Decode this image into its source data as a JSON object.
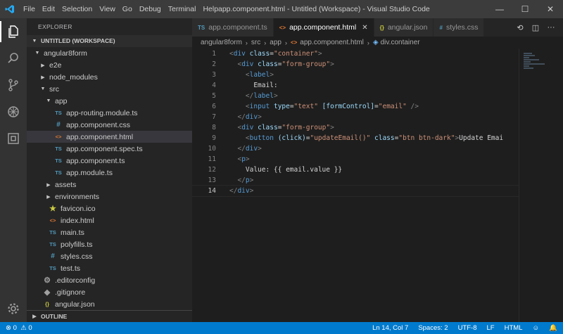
{
  "titlebar": {
    "menu": [
      "File",
      "Edit",
      "Selection",
      "View",
      "Go",
      "Debug",
      "Terminal",
      "Help"
    ],
    "title": "app.component.html - Untitled (Workspace) - Visual Studio Code",
    "controls": [
      "—",
      "☐",
      "✕"
    ]
  },
  "activity": {
    "icons": [
      "files-icon",
      "search-icon",
      "source-control-icon",
      "debug-icon",
      "extensions-icon"
    ],
    "bottom_icon": "settings-gear-icon"
  },
  "sidebar": {
    "title": "EXPLORER",
    "workspace": "UNTITLED (WORKSPACE)",
    "items": [
      {
        "label": "angular8form",
        "kind": "folder-open",
        "depth": 0
      },
      {
        "label": "e2e",
        "kind": "folder",
        "depth": 1
      },
      {
        "label": "node_modules",
        "kind": "folder",
        "depth": 1
      },
      {
        "label": "src",
        "kind": "folder-open",
        "depth": 1
      },
      {
        "label": "app",
        "kind": "folder-open",
        "depth": 2
      },
      {
        "label": "app-routing.module.ts",
        "kind": "ts",
        "depth": 3
      },
      {
        "label": "app.component.css",
        "kind": "css",
        "depth": 3
      },
      {
        "label": "app.component.html",
        "kind": "html",
        "depth": 3,
        "selected": true
      },
      {
        "label": "app.component.spec.ts",
        "kind": "ts",
        "depth": 3
      },
      {
        "label": "app.component.ts",
        "kind": "ts",
        "depth": 3
      },
      {
        "label": "app.module.ts",
        "kind": "ts",
        "depth": 3
      },
      {
        "label": "assets",
        "kind": "folder",
        "depth": 2
      },
      {
        "label": "environments",
        "kind": "folder",
        "depth": 2
      },
      {
        "label": "favicon.ico",
        "kind": "star",
        "depth": 2
      },
      {
        "label": "index.html",
        "kind": "html",
        "depth": 2
      },
      {
        "label": "main.ts",
        "kind": "ts",
        "depth": 2
      },
      {
        "label": "polyfills.ts",
        "kind": "ts",
        "depth": 2
      },
      {
        "label": "styles.css",
        "kind": "css",
        "depth": 2
      },
      {
        "label": "test.ts",
        "kind": "ts",
        "depth": 2
      },
      {
        "label": ".editorconfig",
        "kind": "gear",
        "depth": 1
      },
      {
        "label": ".gitignore",
        "kind": "plain",
        "depth": 1
      },
      {
        "label": "angular.json",
        "kind": "json",
        "depth": 1
      }
    ],
    "outline": "OUTLINE"
  },
  "tabs": [
    {
      "label": "app.component.ts",
      "kind": "ts",
      "active": false
    },
    {
      "label": "app.component.html",
      "kind": "html",
      "active": true
    },
    {
      "label": "angular.json",
      "kind": "json",
      "active": false
    },
    {
      "label": "styles.css",
      "kind": "css",
      "active": false
    }
  ],
  "breadcrumb": [
    "angular8form",
    "src",
    "app",
    "app.component.html",
    "div.container"
  ],
  "editor": {
    "current_line": 14,
    "lines": [
      [
        [
          "tg",
          "<"
        ],
        [
          "tn",
          "div"
        ],
        [
          "tx",
          " "
        ],
        [
          "at",
          "class"
        ],
        [
          "tx",
          "="
        ],
        [
          "av",
          "\"container\""
        ],
        [
          "tg",
          ">"
        ]
      ],
      [
        [
          "tx",
          "  "
        ],
        [
          "tg",
          "<"
        ],
        [
          "tn",
          "div"
        ],
        [
          "tx",
          " "
        ],
        [
          "at",
          "class"
        ],
        [
          "tx",
          "="
        ],
        [
          "av",
          "\"form-group\""
        ],
        [
          "tg",
          ">"
        ]
      ],
      [
        [
          "tx",
          "    "
        ],
        [
          "tg",
          "<"
        ],
        [
          "tn",
          "label"
        ],
        [
          "tg",
          ">"
        ]
      ],
      [
        [
          "tx",
          "      Email:"
        ]
      ],
      [
        [
          "tx",
          "    "
        ],
        [
          "tg",
          "</"
        ],
        [
          "tn",
          "label"
        ],
        [
          "tg",
          ">"
        ]
      ],
      [
        [
          "tx",
          "    "
        ],
        [
          "tg",
          "<"
        ],
        [
          "tn",
          "input"
        ],
        [
          "tx",
          " "
        ],
        [
          "at",
          "type"
        ],
        [
          "tx",
          "="
        ],
        [
          "av",
          "\"text\""
        ],
        [
          "tx",
          " "
        ],
        [
          "at",
          "[formControl]"
        ],
        [
          "tx",
          "="
        ],
        [
          "av",
          "\"email\""
        ],
        [
          "tx",
          " "
        ],
        [
          "tg",
          "/>"
        ]
      ],
      [
        [
          "tx",
          "  "
        ],
        [
          "tg",
          "</"
        ],
        [
          "tn",
          "div"
        ],
        [
          "tg",
          ">"
        ]
      ],
      [
        [
          "tx",
          "  "
        ],
        [
          "tg",
          "<"
        ],
        [
          "tn",
          "div"
        ],
        [
          "tx",
          " "
        ],
        [
          "at",
          "class"
        ],
        [
          "tx",
          "="
        ],
        [
          "av",
          "\"form-group\""
        ],
        [
          "tg",
          ">"
        ]
      ],
      [
        [
          "tx",
          "    "
        ],
        [
          "tg",
          "<"
        ],
        [
          "tn",
          "button"
        ],
        [
          "tx",
          " "
        ],
        [
          "at",
          "(click)"
        ],
        [
          "tx",
          "="
        ],
        [
          "av",
          "\"updateEmail()\""
        ],
        [
          "tx",
          " "
        ],
        [
          "at",
          "class"
        ],
        [
          "tx",
          "="
        ],
        [
          "av",
          "\"btn btn-dark\""
        ],
        [
          "tg",
          ">"
        ],
        [
          "tx",
          "Update Emai"
        ]
      ],
      [
        [
          "tx",
          "  "
        ],
        [
          "tg",
          "</"
        ],
        [
          "tn",
          "div"
        ],
        [
          "tg",
          ">"
        ]
      ],
      [
        [
          "tx",
          "  "
        ],
        [
          "tg",
          "<"
        ],
        [
          "tn",
          "p"
        ],
        [
          "tg",
          ">"
        ]
      ],
      [
        [
          "tx",
          "    Value: {{ email.value }}"
        ]
      ],
      [
        [
          "tx",
          "  "
        ],
        [
          "tg",
          "</"
        ],
        [
          "tn",
          "p"
        ],
        [
          "tg",
          ">"
        ]
      ],
      [
        [
          "tg",
          "</"
        ],
        [
          "tn",
          "div"
        ],
        [
          "tg",
          ">"
        ]
      ]
    ]
  },
  "status": {
    "errors": "0",
    "warnings": "0",
    "position": "Ln 14, Col 7",
    "spaces": "Spaces: 2",
    "encoding": "UTF-8",
    "eol": "LF",
    "language": "HTML"
  },
  "colors": {
    "accent": "#007acc",
    "tag": "#569cd6",
    "attribute": "#9cdcfe",
    "string": "#ce9178"
  }
}
